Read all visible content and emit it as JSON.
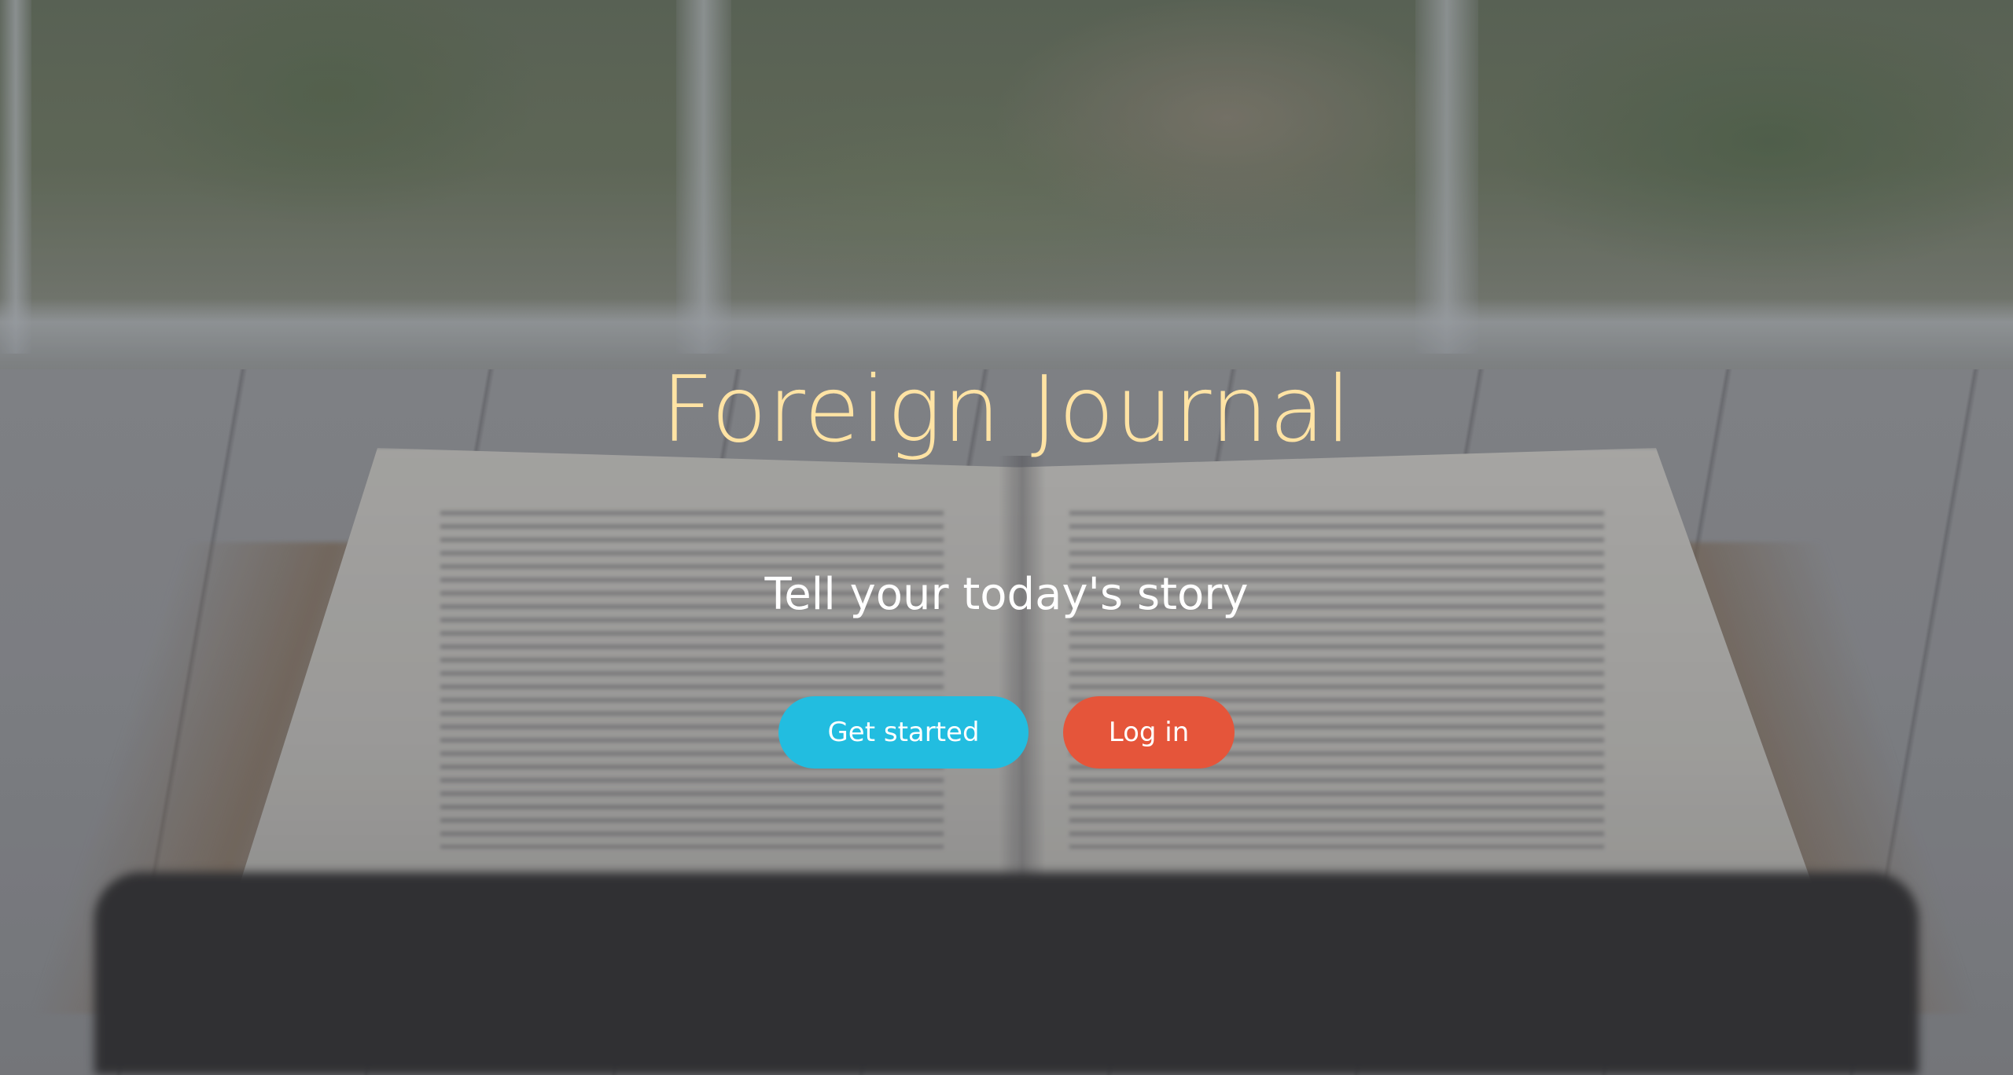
{
  "hero": {
    "title": "Foreign Journal",
    "subtitle": "Tell your today's story"
  },
  "actions": {
    "get_started_label": "Get started",
    "log_in_label": "Log in"
  },
  "colors": {
    "title": "#ffe3a4",
    "primary_button": "#22bde0",
    "secondary_button": "#e5553a",
    "text": "#ffffff"
  },
  "background": {
    "image_description_icon": "open-book-on-table-image"
  }
}
